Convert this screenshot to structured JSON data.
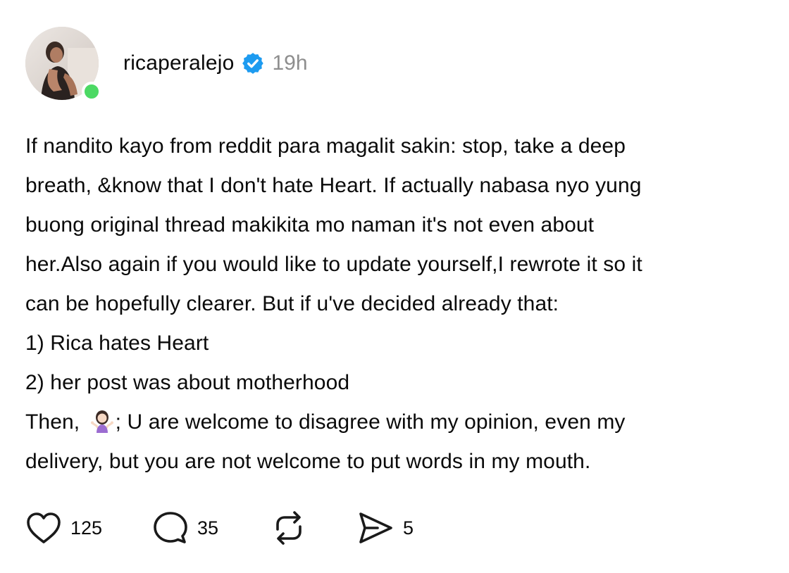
{
  "post": {
    "author": {
      "username": "ricaperalejo",
      "verified": true,
      "online": true,
      "avatar_icon": "profile-photo"
    },
    "timestamp": "19h",
    "body_lines": [
      "If nandito kayo from reddit para magalit sakin: stop, take a deep",
      "breath, &know that I don't hate Heart. If actually nabasa nyo yung",
      "buong original thread makikita mo naman it's not even about",
      "her.Also again if you would like to update yourself,I rewrote it so it",
      "can be hopefully clearer.  But if u've decided already that:",
      "1) Rica hates Heart",
      "2) her post was about motherhood"
    ],
    "then_line": {
      "before_emoji": "Then, ",
      "emoji_icon": "person-shrugging-emoji",
      "after_emoji": "; U are welcome to disagree with my opinion, even my"
    },
    "last_line": "delivery, but you are not welcome to put words in my mouth."
  },
  "actions": {
    "like": {
      "icon": "heart-icon",
      "count": "125"
    },
    "reply": {
      "icon": "comment-bubble-icon",
      "count": "35"
    },
    "repost": {
      "icon": "repost-icon"
    },
    "share": {
      "icon": "send-icon",
      "count": "5"
    }
  },
  "colors": {
    "text": "#0a0a0a",
    "muted": "#8e8e8e",
    "verified": "#1d9bf0",
    "online": "#4cd964",
    "icon": "#1a1a1a"
  }
}
